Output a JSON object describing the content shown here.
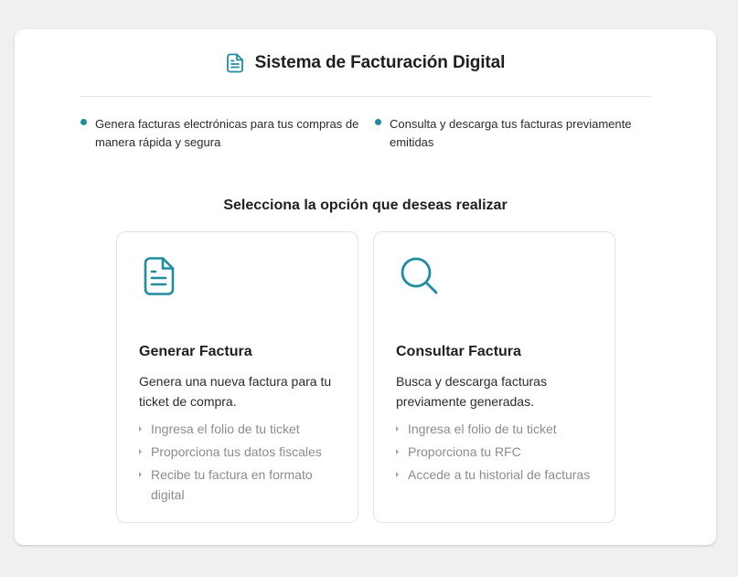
{
  "header": {
    "title": "Sistema de Facturación Digital",
    "icon": "document-icon"
  },
  "features": [
    {
      "text": "Genera facturas electrónicas para tus compras de manera rápida y segura"
    },
    {
      "text": "Consulta y descarga tus facturas previamente emitidas"
    }
  ],
  "subtitle": "Selecciona la opción que deseas realizar",
  "options": [
    {
      "icon": "document-icon",
      "title": "Generar Factura",
      "description": "Genera una nueva factura para tu ticket de compra.",
      "steps": [
        "Ingresa el folio de tu ticket",
        "Proporciona tus datos fiscales",
        "Recibe tu factura en formato digital"
      ]
    },
    {
      "icon": "search-icon",
      "title": "Consultar Factura",
      "description": "Busca y descarga facturas previamente generadas.",
      "steps": [
        "Ingresa el folio de tu ticket",
        "Proporciona tu RFC",
        "Accede a tu historial de facturas"
      ]
    }
  ],
  "colors": {
    "accent": "#1e8e9e",
    "background": "#f0f0f0",
    "card": "#ffffff",
    "muted_text": "#8c8c8c"
  }
}
